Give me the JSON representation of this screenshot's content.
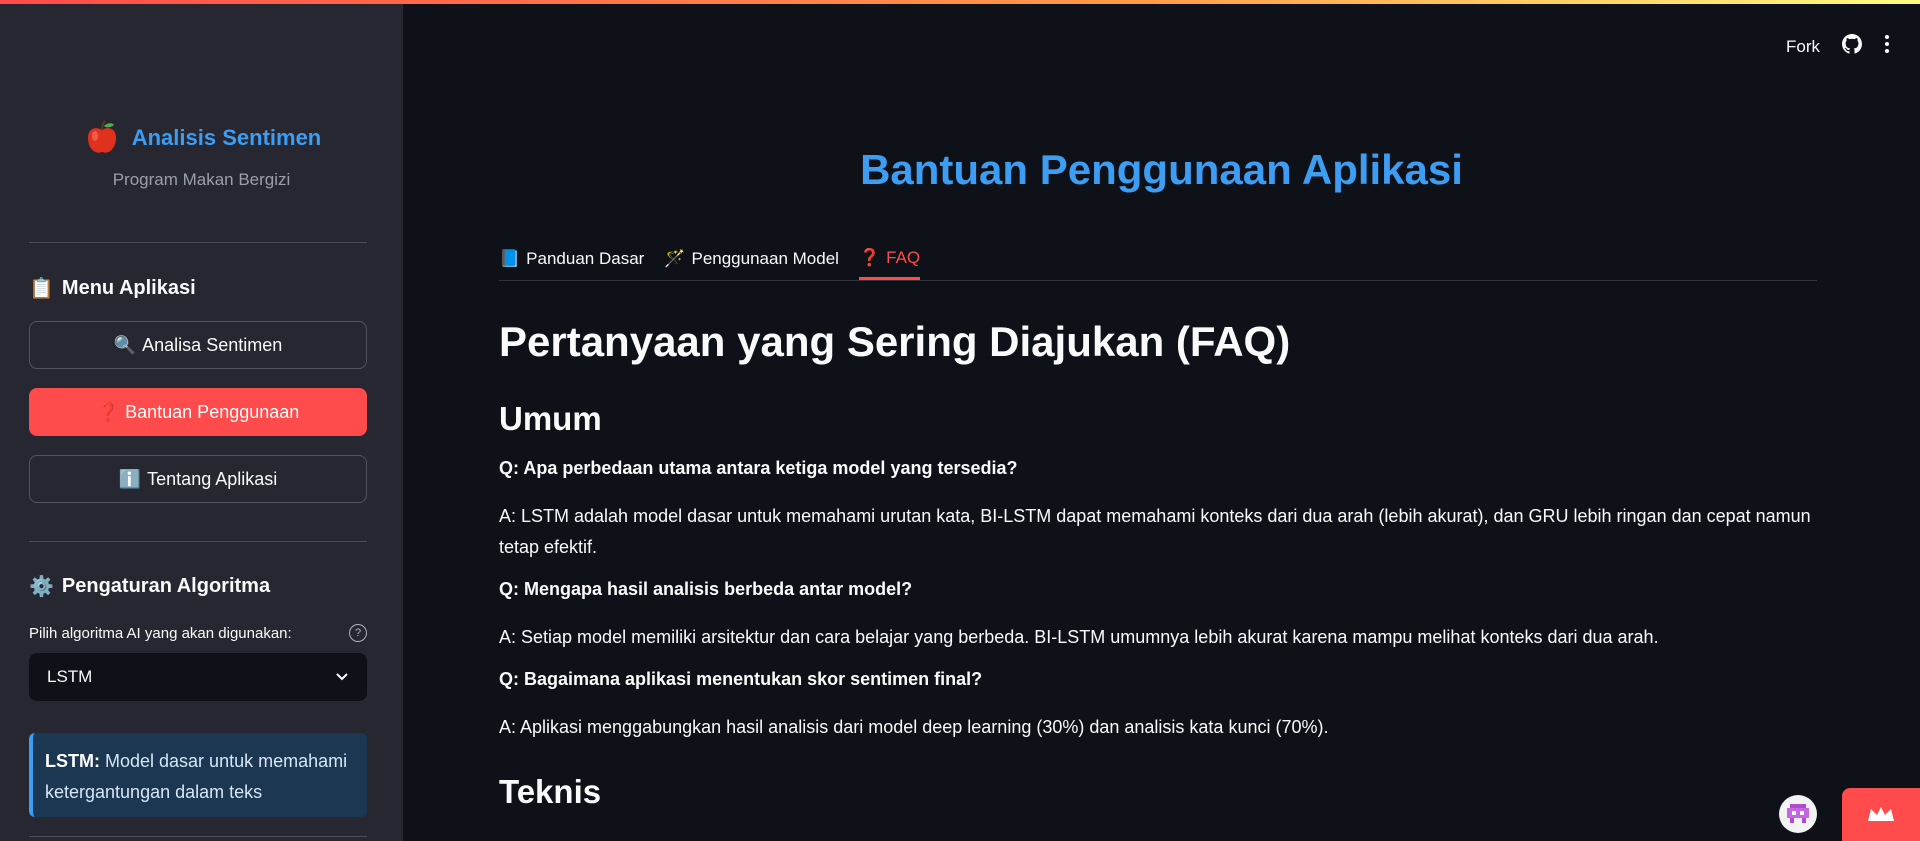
{
  "app": {
    "brand_title": "Analisis Sentimen",
    "brand_subtitle": "Program Makan Bergizi"
  },
  "sidebar": {
    "menu_title": "Menu Aplikasi",
    "menu_icon": "clipboard-icon",
    "buttons": [
      {
        "icon": "🔍",
        "label": "Analisa Sentimen",
        "active": false
      },
      {
        "icon": "❓",
        "label": "Bantuan Penggunaan",
        "active": true
      },
      {
        "icon": "ℹ️",
        "label": "Tentang Aplikasi",
        "active": false
      }
    ],
    "settings_title": "Pengaturan Algoritma",
    "settings_icon": "gear-icon",
    "select_label": "Pilih algoritma AI yang akan digunakan:",
    "select_value": "LSTM",
    "info_bold": "LSTM:",
    "info_text": "Model dasar untuk memahami ketergantungan dalam teks"
  },
  "header": {
    "fork_label": "Fork"
  },
  "main": {
    "title": "Bantuan Penggunaan Aplikasi",
    "tabs": [
      {
        "icon": "📘",
        "label": "Panduan Dasar",
        "active": false
      },
      {
        "icon": "🪄",
        "label": "Penggunaan Model",
        "active": false
      },
      {
        "icon": "❓",
        "label": "FAQ",
        "active": true
      }
    ],
    "faq_title": "Pertanyaan yang Sering Diajukan (FAQ)",
    "section_general": "Umum",
    "qa": [
      {
        "q": "Q: Apa perbedaan utama antara ketiga model yang tersedia?",
        "a": "A: LSTM adalah model dasar untuk memahami urutan kata, BI-LSTM dapat memahami konteks dari dua arah (lebih akurat), dan GRU lebih ringan dan cepat namun tetap efektif."
      },
      {
        "q": "Q: Mengapa hasil analisis berbeda antar model?",
        "a": "A: Setiap model memiliki arsitektur dan cara belajar yang berbeda. BI-LSTM umumnya lebih akurat karena mampu melihat konteks dari dua arah."
      },
      {
        "q": "Q: Bagaimana aplikasi menentukan skor sentimen final?",
        "a": "A: Aplikasi menggabungkan hasil analisis dari model deep learning (30%) dan analisis kata kunci (70%)."
      }
    ],
    "section_technical": "Teknis"
  },
  "colors": {
    "accent": "#ff4b4b",
    "title_blue": "#3d9df3",
    "background": "#0e1117",
    "sidebar_bg": "#262730"
  }
}
